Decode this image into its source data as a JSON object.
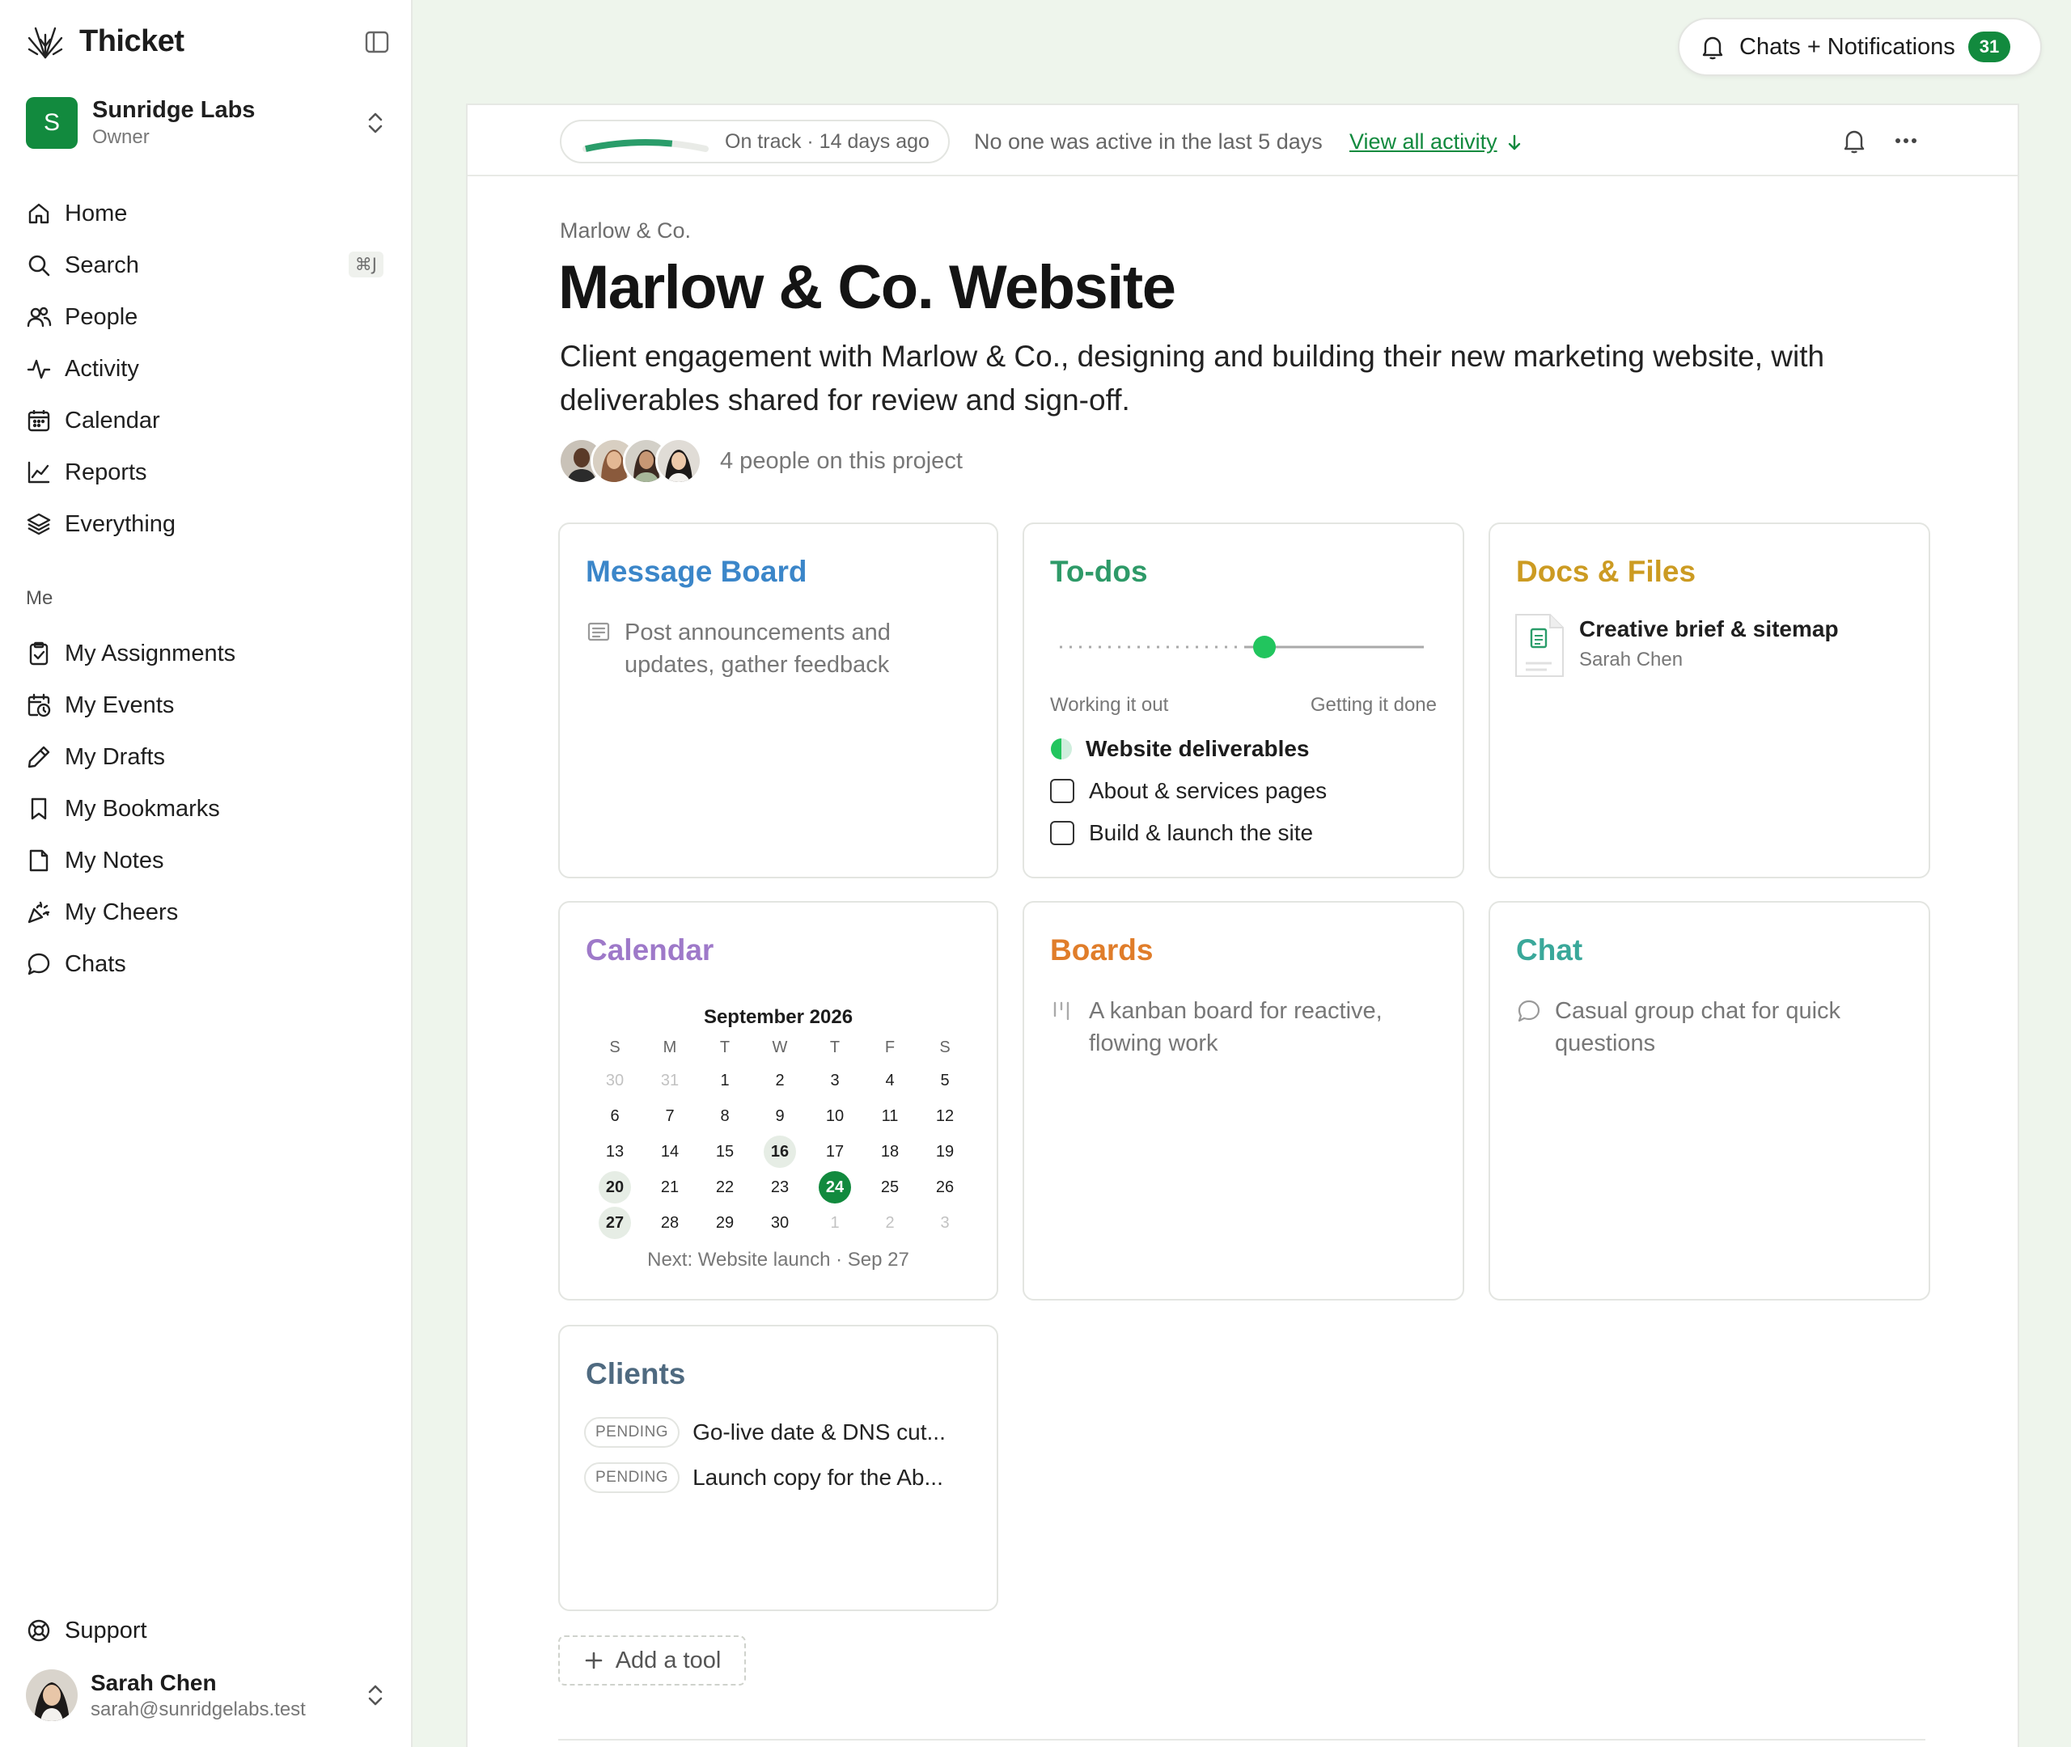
{
  "app": {
    "name": "Thicket"
  },
  "account": {
    "initial": "S",
    "name": "Sunridge Labs",
    "role": "Owner"
  },
  "nav": {
    "home": "Home",
    "search": "Search",
    "search_shortcut": "⌘J",
    "people": "People",
    "activity": "Activity",
    "calendar": "Calendar",
    "reports": "Reports",
    "everything": "Everything",
    "me_section": "Me",
    "my_assignments": "My Assignments",
    "my_events": "My Events",
    "my_drafts": "My Drafts",
    "my_bookmarks": "My Bookmarks",
    "my_notes": "My Notes",
    "my_cheers": "My Cheers",
    "chats": "Chats",
    "support": "Support"
  },
  "user": {
    "name": "Sarah Chen",
    "email": "sarah@sunridgelabs.test"
  },
  "notifications": {
    "label": "Chats + Notifications",
    "count": "31"
  },
  "topbar": {
    "status": "On track · 14 days ago",
    "progress": 0.72,
    "activity_note": "No one was active in the last 5 days",
    "view_activity": "View all activity"
  },
  "project": {
    "client": "Marlow & Co.",
    "title": "Marlow & Co. Website",
    "description": "Client engagement with Marlow & Co., designing and building their new marketing website, with deliverables shared for review and sign-off.",
    "people_count": "4 people on this project"
  },
  "cards": {
    "message_board": {
      "title": "Message Board",
      "desc": "Post announcements and updates, gather feedback",
      "color": "#3b86c9"
    },
    "todos": {
      "title": "To-dos",
      "color": "#2e9a68",
      "hill_left": "Working it out",
      "hill_right": "Getting it done",
      "hill_position": 0.55,
      "list_title": "Website deliverables",
      "items": [
        "About & services pages",
        "Build & launch the site"
      ]
    },
    "docs": {
      "title": "Docs & Files",
      "color": "#cc9b22",
      "doc_name": "Creative brief & sitemap",
      "doc_author": "Sarah Chen"
    },
    "calendar": {
      "title": "Calendar",
      "color": "#9e79c9",
      "month": "September 2026",
      "dow": [
        "S",
        "M",
        "T",
        "W",
        "T",
        "F",
        "S"
      ],
      "days": [
        "30",
        "31",
        "1",
        "2",
        "3",
        "4",
        "5",
        "6",
        "7",
        "8",
        "9",
        "10",
        "11",
        "12",
        "13",
        "14",
        "15",
        "16",
        "17",
        "18",
        "19",
        "20",
        "21",
        "22",
        "23",
        "24",
        "25",
        "26",
        "27",
        "28",
        "29",
        "30",
        "1",
        "2",
        "3"
      ],
      "next": "Next: Website launch · Sep 27"
    },
    "boards": {
      "title": "Boards",
      "color": "#e07d2a",
      "desc": "A kanban board for reactive, flowing work"
    },
    "chat": {
      "title": "Chat",
      "color": "#3aa89a",
      "desc": "Casual group chat for quick questions"
    },
    "clients": {
      "title": "Clients",
      "color": "#4f6a80",
      "rows": [
        {
          "badge": "PENDING",
          "text": "Go-live date & DNS cut..."
        },
        {
          "badge": "PENDING",
          "text": "Launch copy for the Ab..."
        }
      ]
    }
  },
  "add_tool": "Add a tool",
  "colors": {
    "accent": "#128a3e",
    "hill_dot": "#22c55e"
  }
}
